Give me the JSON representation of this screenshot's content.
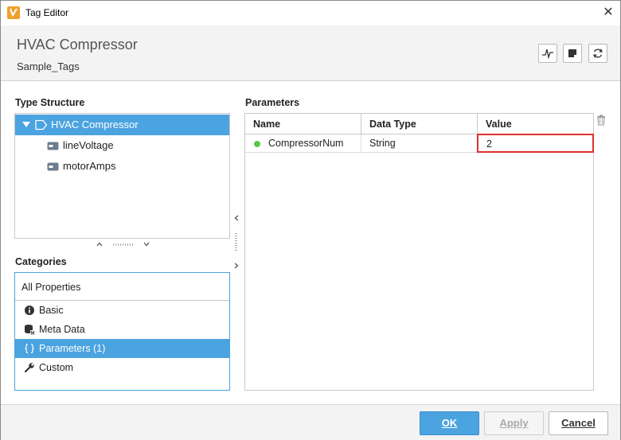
{
  "window": {
    "title": "Tag Editor",
    "close_glyph": "✕"
  },
  "header": {
    "tag_name": "HVAC Compressor",
    "tag_provider": "Sample_Tags",
    "buttons": [
      "trend-icon",
      "note-icon",
      "refresh-icon"
    ]
  },
  "type_structure": {
    "label": "Type Structure",
    "items": [
      {
        "label": "HVAC Compressor",
        "icon": "udt-instance-icon",
        "expanded": true,
        "selected": true
      },
      {
        "label": "lineVoltage",
        "icon": "tag-icon",
        "selected": false
      },
      {
        "label": "motorAmps",
        "icon": "tag-icon",
        "selected": false
      }
    ]
  },
  "categories": {
    "label": "Categories",
    "header": "All Properties",
    "items": [
      {
        "label": "Basic",
        "icon": "info-icon",
        "selected": false
      },
      {
        "label": "Meta Data",
        "icon": "database-icon",
        "selected": false
      },
      {
        "label": "Parameters (1)",
        "icon": "braces-icon",
        "selected": true
      },
      {
        "label": "Custom",
        "icon": "wrench-icon",
        "selected": false
      }
    ]
  },
  "parameters": {
    "label": "Parameters",
    "columns": [
      "Name",
      "Data Type",
      "Value"
    ],
    "rows": [
      {
        "name": "CompressorNum",
        "data_type": "String",
        "value": "2"
      }
    ]
  },
  "footer": {
    "ok_label": "OK",
    "apply_label": "Apply",
    "cancel_label": "Cancel"
  },
  "colors": {
    "accent": "#4ba3e0",
    "highlight": "#e03030",
    "status_ok": "#5ac84a"
  }
}
